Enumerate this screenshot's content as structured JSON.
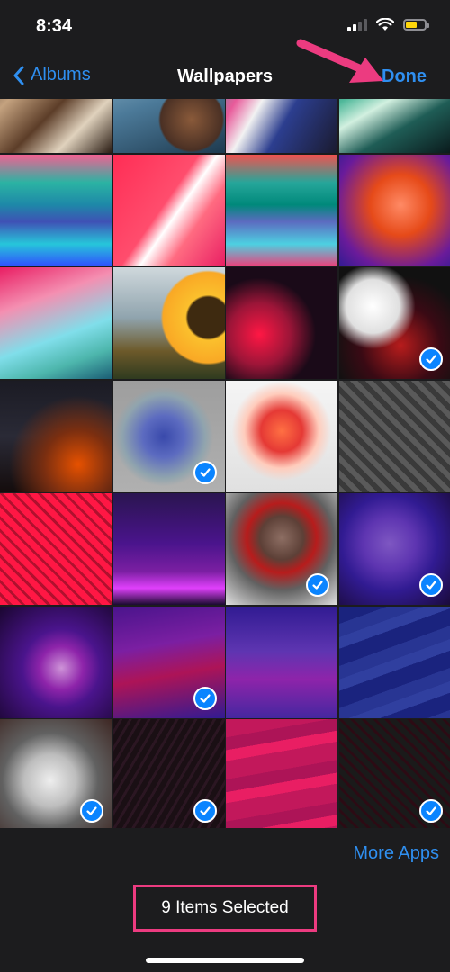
{
  "status": {
    "time": "8:34"
  },
  "nav": {
    "back_label": "Albums",
    "title": "Wallpapers",
    "done_label": "Done"
  },
  "grid": {
    "columns": 4,
    "items": [
      {
        "name": "wallpaper-bookshelf-spiral",
        "selected": false,
        "bg": "linear-gradient(135deg,#3b2a20 0%,#c4a27f 30%,#5c3d28 55%,#e0d2bd 75%,#2b1d14 100%)"
      },
      {
        "name": "wallpaper-blue-cloak",
        "selected": false,
        "bg": "radial-gradient(circle at 70% 70%,#8a5a3a 0%,#4a3024 28%,transparent 30%),linear-gradient(160deg,#9fc3d6 0%,#4c7a99 50%,#1e3a4f 100%)"
      },
      {
        "name": "wallpaper-paint-swirl-teal",
        "selected": false,
        "bg": "linear-gradient(120deg,#2aa39a 0%,#e85a9a 25%,#f2f2f2 40%,#2c3e8f 60%,#1a1a2e 100%)"
      },
      {
        "name": "wallpaper-paint-swirl-green",
        "selected": false,
        "bg": "linear-gradient(150deg,#0d2a2a 0%,#4fb89a 35%,#d2f0e0 50%,#1f5d56 70%,#0a1a1c 100%)"
      },
      {
        "name": "wallpaper-ios-green-waves",
        "selected": false,
        "bg": "linear-gradient(180deg,#f06292 0%,#2bb3a3 25%,#1e88a8 45%,#3f51b5 60%,#26c6da 80%,#304ffe 100%)"
      },
      {
        "name": "wallpaper-red-white-fold",
        "selected": false,
        "bg": "linear-gradient(125deg,#ff2d55 0%,#ff4d6d 45%,#ffffff 55%,#ff6b81 70%,#e91e63 100%)"
      },
      {
        "name": "wallpaper-teal-pink-waves",
        "selected": false,
        "bg": "linear-gradient(180deg,#ef5350 0%,#26a69a 25%,#00897b 45%,#5c6bc0 60%,#4dd0e1 80%,#ec407a 100%)"
      },
      {
        "name": "wallpaper-orange-blur",
        "selected": false,
        "bg": "radial-gradient(circle at 55% 45%,#ff8a65 0%,#e64a19 35%,#6a1b9a 75%,#311b92 100%)"
      },
      {
        "name": "wallpaper-pink-teal-abstract",
        "selected": false,
        "bg": "linear-gradient(160deg,#e91e63 0%,#f48fb1 30%,#80deea 60%,#4db6ac 80%,#1b5e75 100%)"
      },
      {
        "name": "wallpaper-sunflower",
        "selected": false,
        "bg": "radial-gradient(circle at 85% 45%,#3e2a10 0%,#3e2a10 18%,#fbc02d 20%,#f9a825 40%,transparent 42%),linear-gradient(180deg,#cfd8dc 0%,#90a4ae 45%,#6d5a2a 75%,#2f3b1f 100%)"
      },
      {
        "name": "wallpaper-black-red-bubbles",
        "selected": false,
        "bg": "radial-gradient(circle at 30% 60%,#ff1744 0%,#9c1538 30%,#1a0a18 55%),radial-gradient(circle at 75% 85%,#e91e63 0%,transparent 35%),#050505"
      },
      {
        "name": "wallpaper-white-red-bubbles",
        "selected": true,
        "bg": "radial-gradient(circle at 30% 35%,#ffffff 0%,#e0e0e0 25%,transparent 40%),radial-gradient(circle at 55% 70%,#b71c1c 0%,#3a0a14 40%,#111 70%)"
      },
      {
        "name": "wallpaper-dark-ember",
        "selected": false,
        "bg": "radial-gradient(circle at 70% 75%,#e65100 0%,#7a2e10 30%,transparent 60%),linear-gradient(180deg,#1b1b24 0%,#2a2a36 50%,#140c0c 100%)"
      },
      {
        "name": "wallpaper-blue-smoke-face",
        "selected": true,
        "bg": "radial-gradient(circle at 45% 50%,#3949ab 0%,#5c6bc0 25%,#90a4ae 50%,transparent 60%),linear-gradient(180deg,#9e9e9e 0%,#b0b0b0 100%)"
      },
      {
        "name": "wallpaper-red-smoke-face",
        "selected": false,
        "bg": "radial-gradient(circle at 50% 45%,#ff7043 0%,#e53935 25%,#ffccbc 45%,transparent 60%),linear-gradient(180deg,#f5f5f5 0%,#e0e0e0 100%)"
      },
      {
        "name": "wallpaper-gray-pattern",
        "selected": false,
        "bg": "repeating-linear-gradient(45deg,#5a5a5a 0 6px,#3a3a3a 6px 12px),#444"
      },
      {
        "name": "wallpaper-red-pattern",
        "selected": false,
        "bg": "repeating-linear-gradient(45deg,#ff1744 0 7px,#b0102e 7px 10px),#e53935"
      },
      {
        "name": "wallpaper-purple-dunes",
        "selected": false,
        "bg": "linear-gradient(180deg,#2a1550 0%,#4a148c 45%,#7b1fa2 70%,#e040fb 85%,#1a0a30 100%)"
      },
      {
        "name": "wallpaper-deadpool-cable",
        "selected": true,
        "bg": "radial-gradient(circle at 50% 40%,#8d6e63 0%,#5d4037 25%,#b71c1c 40%,#616161 60%,#e0e0e0 100%)"
      },
      {
        "name": "wallpaper-purple-circle",
        "selected": true,
        "bg": "radial-gradient(circle at 45% 45%,#7e57c2 0%,#5e35b1 30%,#311b92 55%,#1a0a3a 100%)"
      },
      {
        "name": "wallpaper-purple-orb",
        "selected": false,
        "bg": "radial-gradient(circle at 55% 55%,#ce93d8 0%,#8e24aa 25%,#4a148c 45%,#1a0630 100%)"
      },
      {
        "name": "wallpaper-purple-ridges",
        "selected": true,
        "bg": "linear-gradient(170deg,#4a148c 0%,#7b1fa2 35%,#ad1457 60%,#311b92 100%)"
      },
      {
        "name": "wallpaper-purple-valley",
        "selected": false,
        "bg": "linear-gradient(180deg,#311b92 0%,#5e35b1 40%,#8e24aa 65%,#4527a0 100%)"
      },
      {
        "name": "wallpaper-blue-waves",
        "selected": false,
        "bg": "repeating-linear-gradient(160deg,#1a237e 0 18px,#283593 18px 32px,#303f9f 32px 44px)"
      },
      {
        "name": "wallpaper-steam-cavern",
        "selected": true,
        "bg": "radial-gradient(ellipse at 45% 55%,#eeeeee 0%,#bdbdbd 30%,#616161 55%,#3e2723 100%)"
      },
      {
        "name": "wallpaper-dark-lines",
        "selected": true,
        "bg": "repeating-linear-gradient(120deg,#1a0f14 0 6px,#2b1622 6px 9px),#140b10"
      },
      {
        "name": "wallpaper-magenta-waves",
        "selected": false,
        "bg": "repeating-linear-gradient(170deg,#c2185b 0 20px,#ad1457 20px 34px,#e91e63 34px 46px)"
      },
      {
        "name": "wallpaper-dark-pattern",
        "selected": true,
        "bg": "repeating-linear-gradient(45deg,#1a1a1a 0 6px,#2c0b14 6px 9px),#101010"
      }
    ]
  },
  "toolbar": {
    "more_apps_label": "More Apps",
    "selection_label": "9 Items Selected"
  },
  "colors": {
    "accent": "#2f8ff0",
    "checkmark": "#0a84ff",
    "annotation": "#ec3b80"
  }
}
